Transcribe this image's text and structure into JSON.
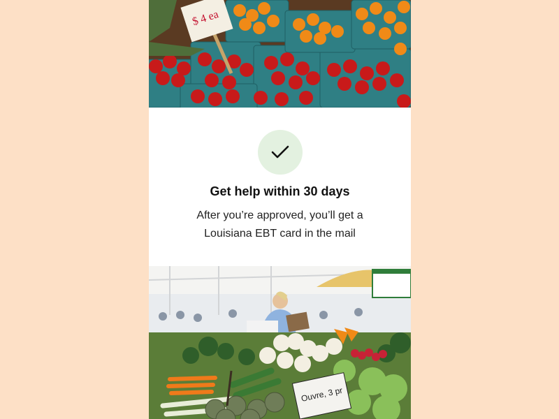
{
  "card": {
    "icon": "checkmark-icon",
    "title": "Get help within 30 days",
    "body": "After you’re approved, you’ll get a Louisiana EBT card in the mail"
  },
  "images": {
    "top": "tomatoes-photo",
    "bottom": "farmers-market-photo",
    "top_sign_text": "$ 4 ea",
    "bottom_sign_text": "Ouvre, 3 pr"
  },
  "colors": {
    "background": "#fde0c6",
    "card": "#ffffff",
    "check_circle": "#e3f1e0",
    "title": "#111111"
  }
}
